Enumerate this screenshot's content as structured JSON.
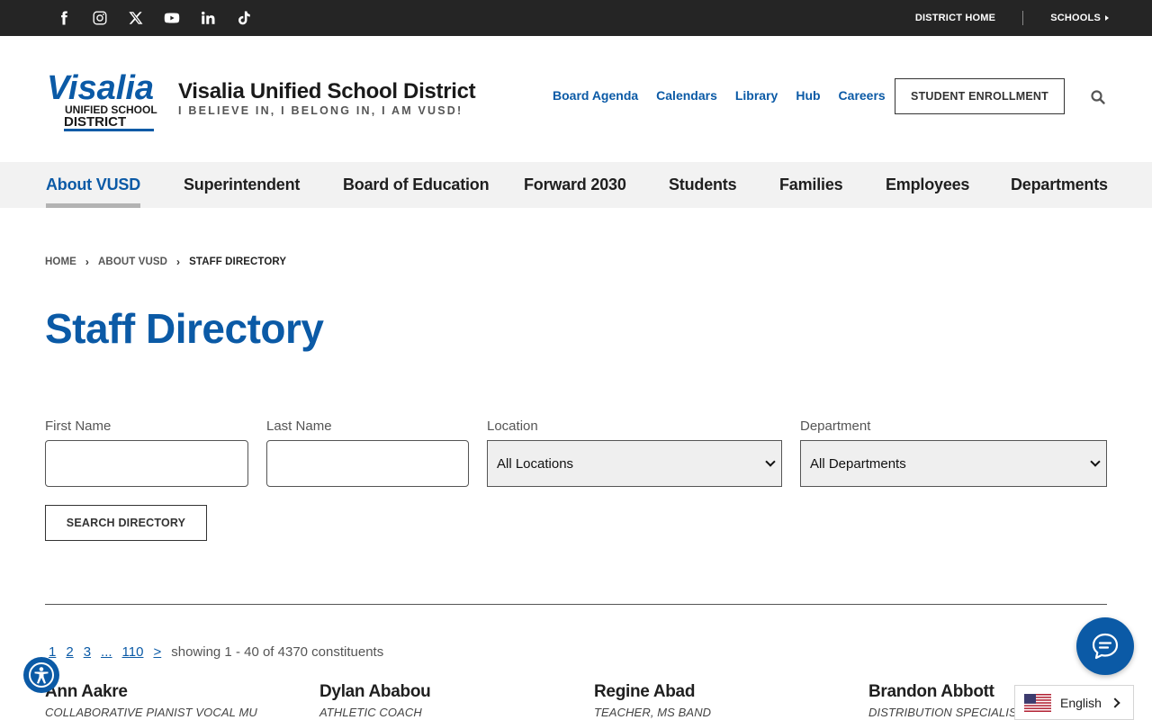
{
  "topbar": {
    "social_icons": [
      "facebook-icon",
      "instagram-icon",
      "x-icon",
      "youtube-icon",
      "linkedin-icon",
      "tiktok-icon"
    ],
    "district_home": "DISTRICT HOME",
    "schools": "SCHOOLS"
  },
  "header": {
    "logo_text_top": "Visalia",
    "logo_text_mid": "UNIFIED SCHOOL",
    "logo_text_bottom": "DISTRICT",
    "title": "Visalia Unified School District",
    "tagline": "I BELIEVE IN, I BELONG IN, I AM VUSD!",
    "quicklinks": [
      "Board Agenda",
      "Calendars",
      "Library",
      "Hub",
      "Careers"
    ],
    "enroll_button": "STUDENT ENROLLMENT"
  },
  "nav": {
    "items": [
      "About VUSD",
      "Superintendent",
      "Board of Education",
      "Forward 2030",
      "Students",
      "Families",
      "Employees",
      "Departments"
    ],
    "active": "About VUSD"
  },
  "breadcrumb": [
    "HOME",
    "ABOUT VUSD",
    "STAFF DIRECTORY"
  ],
  "page_title": "Staff Directory",
  "form": {
    "first_name_label": "First Name",
    "first_name_value": "",
    "last_name_label": "Last Name",
    "last_name_value": "",
    "location_label": "Location",
    "location_value": "All Locations",
    "department_label": "Department",
    "department_value": "All Departments",
    "search_button": "SEARCH DIRECTORY"
  },
  "pager": {
    "pages": [
      "1",
      "2",
      "3",
      "...",
      "110",
      ">"
    ],
    "showing": "showing 1 - 40 of 4370 constituents"
  },
  "staff": [
    {
      "name": "Ann Aakre",
      "role": "COLLABORATIVE PIANIST VOCAL MU"
    },
    {
      "name": "Dylan Ababou",
      "role": "ATHLETIC COACH"
    },
    {
      "name": "Regine Abad",
      "role": "TEACHER, MS BAND"
    },
    {
      "name": "Brandon Abbott",
      "role": "DISTRIBUTION SPECIALIST"
    }
  ],
  "language": {
    "label": "English"
  },
  "colors": {
    "brand_blue": "#0b5aa6",
    "topbar": "#252525",
    "nav_bg": "#f2f2f2"
  }
}
